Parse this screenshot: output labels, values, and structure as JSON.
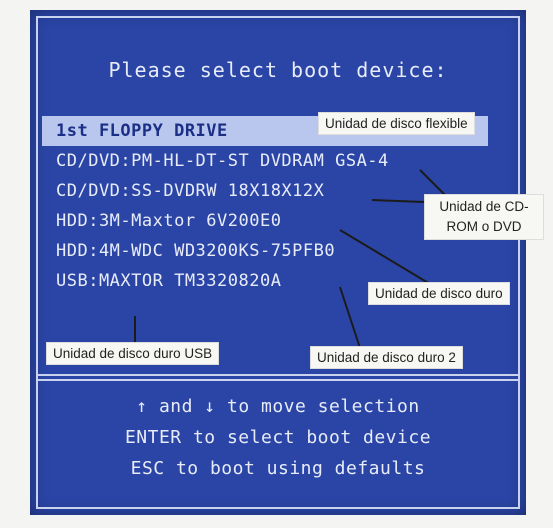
{
  "title": "Please select boot device:",
  "menu": {
    "items": [
      {
        "label": "1st FLOPPY DRIVE",
        "selected": true
      },
      {
        "label": "CD/DVD:PM-HL-DT-ST DVDRAM GSA-4",
        "selected": false
      },
      {
        "label": "CD/DVD:SS-DVDRW 18X18X12X",
        "selected": false
      },
      {
        "label": "HDD:3M-Maxtor 6V200E0",
        "selected": false
      },
      {
        "label": "HDD:4M-WDC WD3200KS-75PFB0",
        "selected": false
      },
      {
        "label": "USB:MAXTOR TM3320820A",
        "selected": false
      }
    ]
  },
  "help": {
    "line1": "↑ and ↓ to move selection",
    "line2": "ENTER to select boot device",
    "line3": "ESC to boot using defaults"
  },
  "annotations": {
    "floppy": "Unidad de disco flexible",
    "cdrom": "Unidad de CD-ROM o DVD",
    "hdd": "Unidad de disco duro",
    "usb": "Unidad de disco duro USB",
    "hdd2": "Unidad de disco duro 2"
  },
  "colors": {
    "screen": "#2a45a6",
    "text": "#e8ecf8",
    "highlight": "#b9c6ee"
  }
}
